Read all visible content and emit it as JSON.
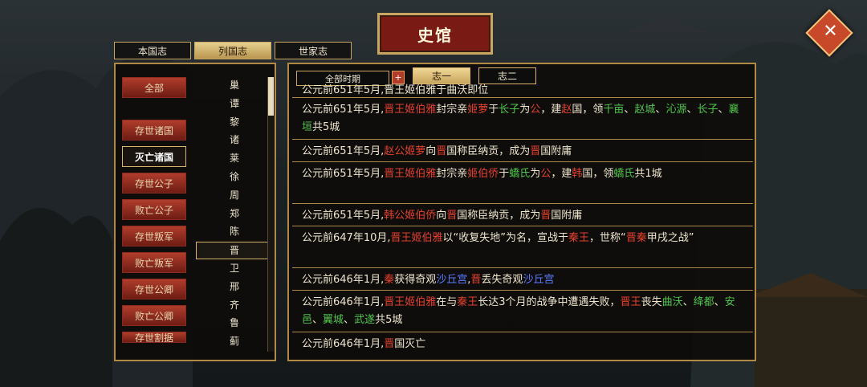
{
  "title": "史馆",
  "close_icon": "✕",
  "tabs": [
    {
      "label": "本国志"
    },
    {
      "label": "列国志"
    },
    {
      "label": "世家志"
    }
  ],
  "active_tab": 1,
  "side_buttons": [
    {
      "label": "全部"
    },
    {
      "label": "存世诸国"
    },
    {
      "label": "灭亡诸国"
    },
    {
      "label": "存世公子"
    },
    {
      "label": "败亡公子"
    },
    {
      "label": "存世叛军"
    },
    {
      "label": "败亡叛军"
    },
    {
      "label": "存世公卿"
    },
    {
      "label": "败亡公卿"
    },
    {
      "label": "存世割据"
    }
  ],
  "side_selected": 2,
  "states": [
    "巢",
    "谭",
    "黎",
    "诸",
    "莱",
    "徐",
    "周",
    "郑",
    "陈",
    "晋",
    "卫",
    "邢",
    "齐",
    "鲁",
    "蓟"
  ],
  "state_selected": 9,
  "period_label": "全部时期",
  "plus_label": "+",
  "volumes": [
    {
      "label": "志一"
    },
    {
      "label": "志二"
    }
  ],
  "top_partial": "公元前651年5月,晋王姬伯雅于曲沃即位",
  "records": [
    [
      [
        "公元前651年5月,",
        ""
      ],
      [
        "晋王姬伯雅",
        "r"
      ],
      [
        "封宗亲",
        ""
      ],
      [
        "姬萝",
        "r"
      ],
      [
        "于",
        ""
      ],
      [
        "长子",
        "g"
      ],
      [
        "为",
        ""
      ],
      [
        "公",
        "r"
      ],
      [
        "，建",
        ""
      ],
      [
        "赵",
        "r"
      ],
      [
        "国，领",
        ""
      ],
      [
        "千亩",
        "g"
      ],
      [
        "、",
        ""
      ],
      [
        "赵城",
        "g"
      ],
      [
        "、",
        ""
      ],
      [
        "沁源",
        "g"
      ],
      [
        "、",
        ""
      ],
      [
        "长子",
        "g"
      ],
      [
        "、",
        ""
      ],
      [
        "襄垣",
        "g"
      ],
      [
        "共5城",
        ""
      ]
    ],
    [
      [
        "公元前651年5月,",
        ""
      ],
      [
        "赵公姬萝",
        "r"
      ],
      [
        "向",
        ""
      ],
      [
        "晋",
        "r"
      ],
      [
        "国称臣纳贡，成为",
        ""
      ],
      [
        "晋",
        "r"
      ],
      [
        "国附庸",
        ""
      ]
    ],
    [
      [
        "公元前651年5月,",
        ""
      ],
      [
        "晋王姬伯雅",
        "r"
      ],
      [
        "封宗亲",
        ""
      ],
      [
        "姬伯侨",
        "r"
      ],
      [
        "于",
        ""
      ],
      [
        "蟜氏",
        "g"
      ],
      [
        "为",
        ""
      ],
      [
        "公",
        "r"
      ],
      [
        "，建",
        ""
      ],
      [
        "韩",
        "r"
      ],
      [
        "国，领",
        ""
      ],
      [
        "蟜氏",
        "g"
      ],
      [
        "共1城",
        ""
      ]
    ],
    [
      [
        "公元前651年5月,",
        ""
      ],
      [
        "韩公姬伯侨",
        "r"
      ],
      [
        "向",
        ""
      ],
      [
        "晋",
        "r"
      ],
      [
        "国称臣纳贡，成为",
        ""
      ],
      [
        "晋",
        "r"
      ],
      [
        "国附庸",
        ""
      ]
    ],
    [
      [
        "公元前647年10月,",
        ""
      ],
      [
        "晋王姬伯雅",
        "r"
      ],
      [
        "以“收复失地”为名，宣战于",
        ""
      ],
      [
        "秦王",
        "r"
      ],
      [
        "，世称“",
        ""
      ],
      [
        "晋秦",
        "r"
      ],
      [
        "甲戌之战”",
        ""
      ]
    ],
    [
      [
        "公元前646年1月,",
        ""
      ],
      [
        "秦",
        "r"
      ],
      [
        "获得奇观",
        ""
      ],
      [
        "沙丘宫",
        "b"
      ],
      [
        ",",
        ""
      ],
      [
        "晋",
        "r"
      ],
      [
        "丢失奇观",
        ""
      ],
      [
        "沙丘宫",
        "b"
      ]
    ],
    [
      [
        "公元前646年1月,",
        ""
      ],
      [
        "晋王姬伯雅",
        "r"
      ],
      [
        "在与",
        ""
      ],
      [
        "秦王",
        "r"
      ],
      [
        "长达3个月的战争中遭遇失败，",
        ""
      ],
      [
        "晋王",
        "r"
      ],
      [
        "丧失",
        ""
      ],
      [
        "曲沃",
        "g"
      ],
      [
        "、",
        ""
      ],
      [
        "绛都",
        "g"
      ],
      [
        "、",
        ""
      ],
      [
        "安邑",
        "g"
      ],
      [
        "、",
        ""
      ],
      [
        "翼城",
        "g"
      ],
      [
        "、",
        ""
      ],
      [
        "武遂",
        "g"
      ],
      [
        "共5城",
        ""
      ]
    ],
    [
      [
        "公元前646年1月,",
        ""
      ],
      [
        "晋",
        "r"
      ],
      [
        "国灭亡",
        ""
      ]
    ]
  ],
  "colors": {
    "accent_red": "#e5402c",
    "place_green": "#4fc64a",
    "wonder_blue": "#5c7aff",
    "gold_border": "#c9a760"
  }
}
